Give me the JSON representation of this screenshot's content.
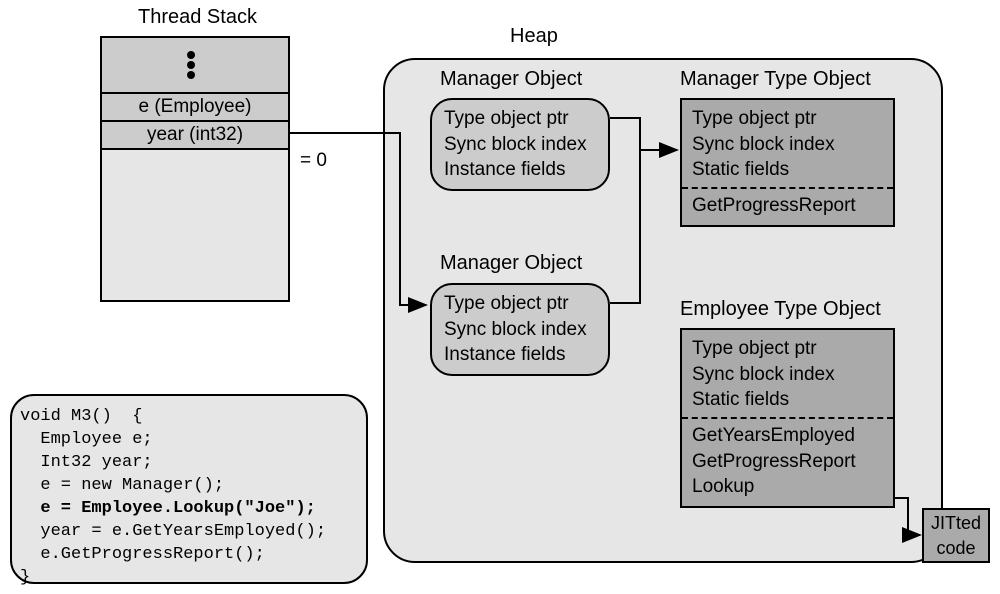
{
  "titles": {
    "thread_stack": "Thread Stack",
    "heap": "Heap",
    "manager_object1": "Manager Object",
    "manager_object2": "Manager Object",
    "manager_type": "Manager Type Object",
    "employee_type": "Employee Type Object"
  },
  "stack": {
    "cell1": "e (Employee)",
    "cell2": "year (int32)",
    "equals": "=   0"
  },
  "instance": {
    "line1": "Type object ptr",
    "line2": "Sync block index",
    "line3": "Instance fields"
  },
  "manager_type": {
    "line1": "Type object ptr",
    "line2": "Sync block index",
    "line3": "Static fields",
    "method1": "GetProgressReport"
  },
  "employee_type": {
    "line1": "Type object ptr",
    "line2": "Sync block index",
    "line3": "Static fields",
    "method1": "GetYearsEmployed",
    "method2": "GetProgressReport",
    "method3": "Lookup"
  },
  "jit": {
    "line1": "JITted",
    "line2": "code"
  },
  "code": {
    "l1": "void M3()  {",
    "l2": "  Employee e;",
    "l3": "  Int32 year;",
    "l4": "  e = new Manager();",
    "l5": "  e = Employee.Lookup(\"Joe\");",
    "l6": "  year = e.GetYearsEmployed();",
    "l7": "  e.GetProgressReport();",
    "l8": "}"
  }
}
